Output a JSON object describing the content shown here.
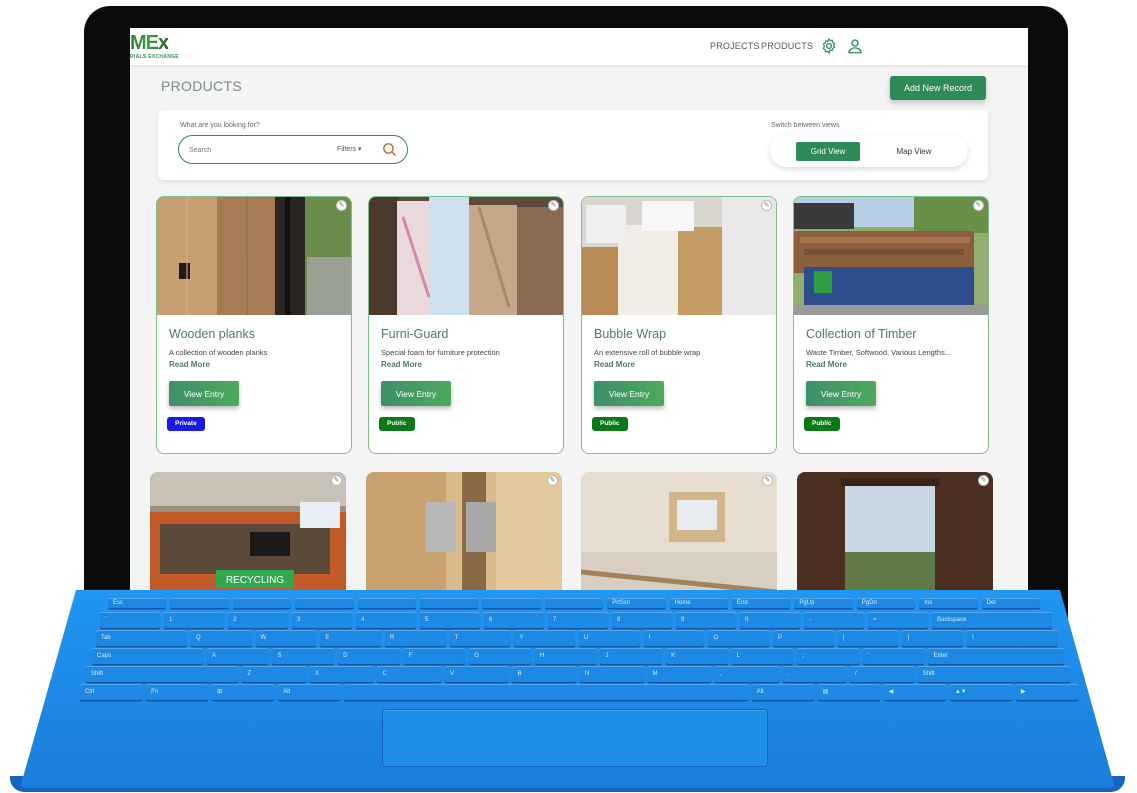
{
  "brand": {
    "logo_text": "MEx",
    "logo_subtext": "RIALS EXCHANGE"
  },
  "nav": {
    "projects": "PROJECTS",
    "products": "PRODUCTS",
    "settings_icon": "gear-icon",
    "user_icon": "user-icon"
  },
  "page": {
    "title": "PRODUCTS",
    "add_button": "Add New Record"
  },
  "search": {
    "prompt": "What are you looking for?",
    "placeholder": "Search",
    "filters_label": "Filters ▾",
    "switch_label": "Switch between views",
    "grid_view": "Grid View",
    "map_view": "Map View"
  },
  "products": [
    {
      "title": "Wooden planks",
      "description": "A collection of wooden planks",
      "read_more": "Read More",
      "button": "View Entry",
      "visibility": "Private",
      "badge_color": "#1a1ae6"
    },
    {
      "title": "Furni-Guard",
      "description": "Special foam for furniture protection",
      "read_more": "Read More",
      "button": "View Entry",
      "visibility": "Public",
      "badge_color": "#0b7a16"
    },
    {
      "title": "Bubble Wrap",
      "description": "An extensive roll of bubble wrap",
      "read_more": "Read More",
      "button": "View Entry",
      "visibility": "Public",
      "badge_color": "#0b7a16"
    },
    {
      "title": "Collection of Timber",
      "description": "Waste Timber, Softwood, Various Lengths...",
      "read_more": "Read More",
      "button": "View Entry",
      "visibility": "Public",
      "badge_color": "#0b7a16"
    }
  ],
  "second_row": {
    "recycling_sign": "RECYCLING"
  },
  "keyboard": {
    "row1": [
      "Esc",
      "",
      "",
      "",
      "",
      "",
      "",
      "",
      "PrtScn",
      "Home",
      "End",
      "PgUp",
      "PgDn",
      "Ins",
      "Del"
    ],
    "row2": [
      "`",
      "1",
      "2",
      "3",
      "4",
      "5",
      "6",
      "7",
      "8",
      "9",
      "0",
      "-",
      "=",
      "Backspace"
    ],
    "row3": [
      "Tab",
      "Q",
      "W",
      "E",
      "R",
      "T",
      "Y",
      "U",
      "I",
      "O",
      "P",
      "[",
      "]",
      "\\"
    ],
    "row4": [
      "Caps",
      "A",
      "S",
      "D",
      "F",
      "G",
      "H",
      "J",
      "K",
      "L",
      ";",
      "'",
      "Enter"
    ],
    "row5": [
      "Shift",
      "Z",
      "X",
      "C",
      "V",
      "B",
      "N",
      "M",
      ",",
      ".",
      "/",
      "Shift"
    ],
    "row6": [
      "Ctrl",
      "Fn",
      "⊞",
      "Alt",
      "",
      "Alt",
      "▤",
      "◀",
      "▲▼",
      "▶"
    ]
  },
  "colors": {
    "accent": "#2e8b57",
    "keyboard": "#1e88e5"
  }
}
